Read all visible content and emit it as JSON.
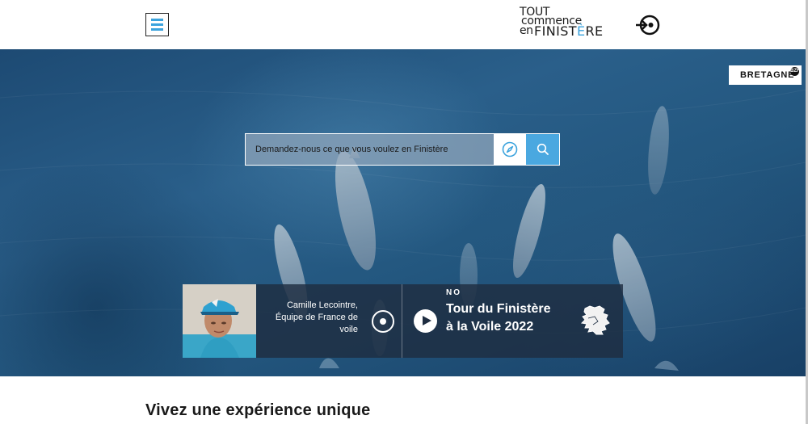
{
  "header": {
    "menu_label": "Menu",
    "logo": {
      "line1": "TOUT",
      "line2": "commence",
      "line3_prefix": "en",
      "line3_main": "FINIST",
      "line3_accent": "È",
      "line3_end": "RE"
    },
    "login_label": "Se connecter"
  },
  "hero": {
    "badge": {
      "label": "BRETAGNE",
      "sup": "BZH"
    },
    "search": {
      "placeholder": "Demandez-nous ce que vous voulez en Finistère",
      "value": ""
    },
    "card": {
      "person_name": "Camille Lecointre,",
      "person_role": "Équipe de France de voile",
      "tag": "NO",
      "title": "Tour du Finistère à la Voile 2022"
    }
  },
  "main": {
    "section_title": "Vivez une expérience unique"
  },
  "colors": {
    "accent": "#4aa8e0",
    "hero_sea": "#23577f",
    "card_bg": "#1e2d41"
  }
}
